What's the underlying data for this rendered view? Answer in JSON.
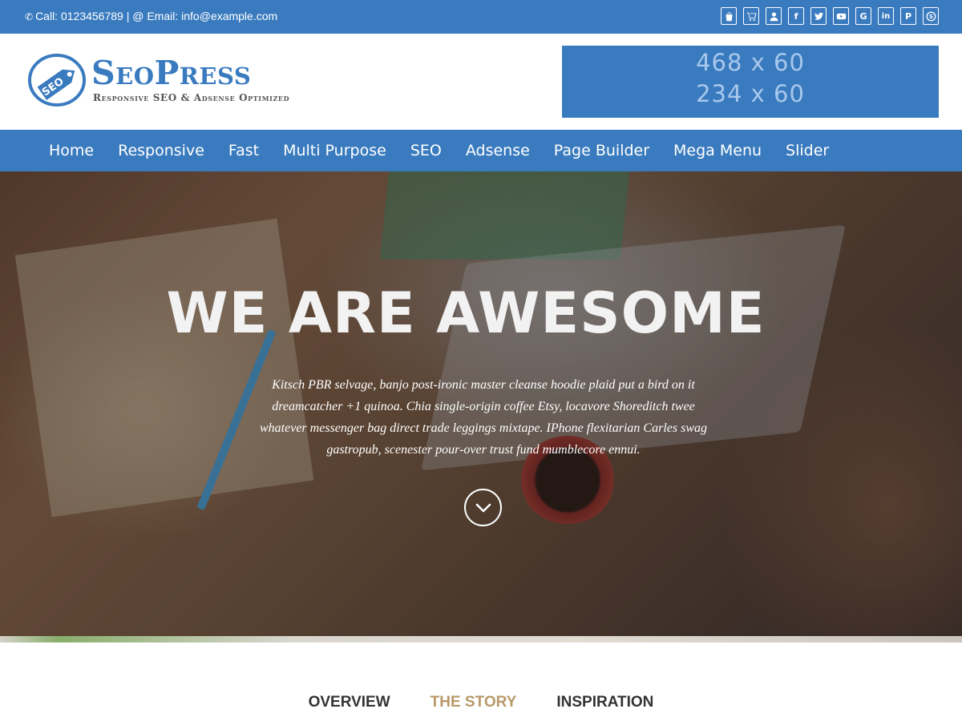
{
  "topbar": {
    "contact_text": "Call: 0123456789 | @ Email: info@example.com",
    "social_icons": [
      "shopping-bag-icon",
      "cart-icon",
      "user-icon",
      "facebook-icon",
      "twitter-icon",
      "youtube-icon",
      "google-icon",
      "linkedin-icon",
      "pinterest-icon",
      "skype-icon"
    ]
  },
  "logo": {
    "badge_text": "SEO",
    "name": "SeoPress",
    "tagline": "Responsive SEO & Adsense Optimized"
  },
  "ad": {
    "line1": "468 x 60",
    "line2": "234 x 60"
  },
  "nav": {
    "items": [
      "Home",
      "Responsive",
      "Fast",
      "Multi Purpose",
      "SEO",
      "Adsense",
      "Page Builder",
      "Mega Menu",
      "Slider"
    ]
  },
  "hero": {
    "title": "WE ARE  AWESOME",
    "text": "Kitsch PBR selvage, banjo post-ironic master cleanse hoodie plaid put a bird on it dreamcatcher +1 quinoa. Chia single-origin coffee Etsy, locavore Shoreditch twee whatever messenger bag direct trade leggings mixtape. IPhone flexitarian Carles swag gastropub, scenester pour-over trust fund mumblecore ennui."
  },
  "tabs": {
    "items": [
      "OVERVIEW",
      "THE STORY",
      "INSPIRATION"
    ],
    "active": "THE STORY"
  },
  "colors": {
    "brand_blue": "#3a7bbf",
    "ad_text": "#a8c8ec",
    "tab_active": "#b89968",
    "tab_default": "#333333"
  }
}
